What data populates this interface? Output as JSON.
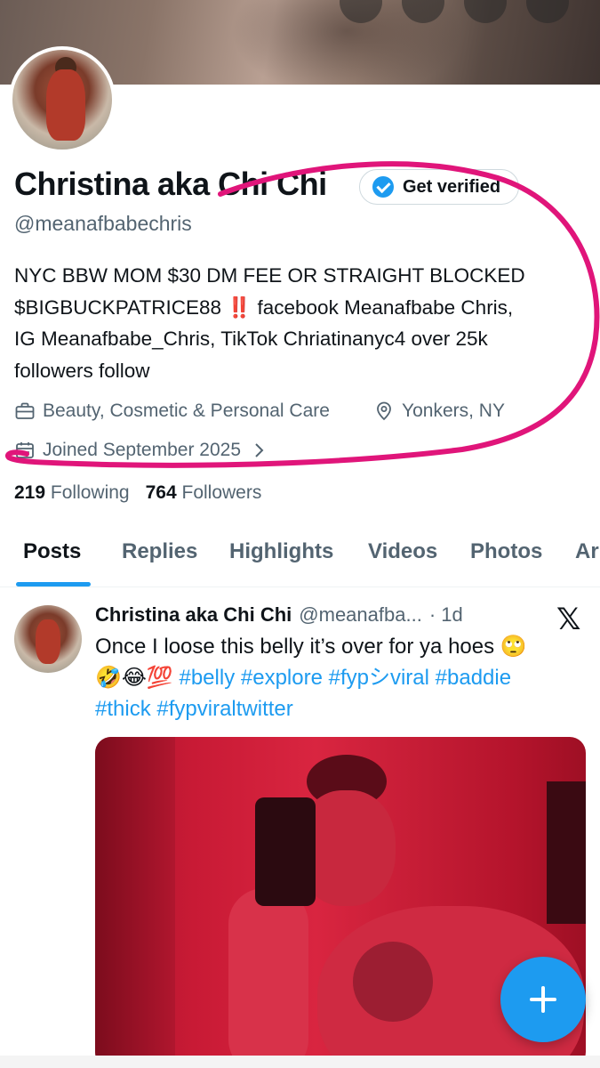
{
  "profile": {
    "name": "Christina aka Chi Chi",
    "verify_label": "Get verified",
    "handle": "@meanafbabechris",
    "bio_lines": [
      "NYC BBW MOM $30 DM FEE OR STRAIGHT BLOCKED",
      "$BIGBUCKPATRICE88 ‼️ facebook Meanafbabe Chris,",
      "IG Meanafbabe_Chris, TikTok Chriatinanyc4 over 25k",
      "followers follow"
    ],
    "category": "Beauty, Cosmetic & Personal Care",
    "location": "Yonkers, NY",
    "joined": "Joined September 2025",
    "following_count": "219",
    "following_label": "Following",
    "followers_count": "764",
    "followers_label": "Followers"
  },
  "tabs": [
    "Posts",
    "Replies",
    "Highlights",
    "Videos",
    "Photos",
    "Ar"
  ],
  "post": {
    "name": "Christina aka Chi Chi",
    "handle": "@meanafba...",
    "time": "· 1d",
    "text": "Once I loose this belly it’s over for ya hoes 🙄",
    "emojis": "🤣😂💯",
    "hashtags_line1": [
      "#belly",
      "#explore",
      "#fypシviral",
      "#baddie"
    ],
    "hashtags_line2": [
      "#thick",
      "#fypviraltwitter"
    ]
  },
  "icons": {
    "category": "briefcase-icon",
    "location": "location-pin-icon",
    "joined": "calendar-icon",
    "post_logo": "x-logo-icon",
    "compose": "plus-icon"
  },
  "colors": {
    "accent": "#1d9bf0",
    "annotation": "#e0157a",
    "muted_text": "#536471"
  }
}
